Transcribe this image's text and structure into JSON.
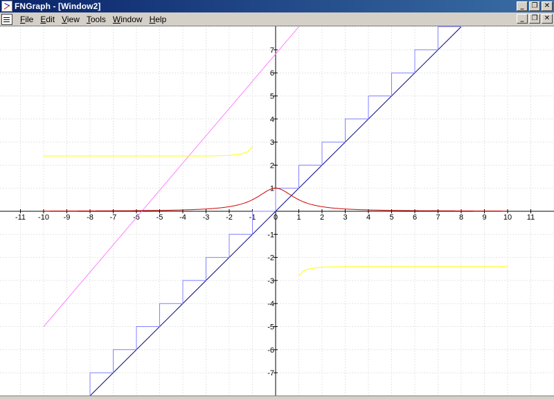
{
  "window": {
    "title": "FNGraph - [Window2]",
    "caption_buttons": [
      "_",
      "❐",
      "✕"
    ]
  },
  "menu": {
    "items": [
      "File",
      "Edit",
      "View",
      "Tools",
      "Window",
      "Help"
    ],
    "mnemonics": [
      "F",
      "E",
      "V",
      "T",
      "W",
      "H"
    ]
  },
  "chart_data": {
    "type": "line",
    "grid": true,
    "xlim": [
      -12,
      12
    ],
    "ylim": [
      -8,
      8
    ],
    "x_ticks": [
      -11,
      -10,
      -9,
      -8,
      -7,
      -6,
      -5,
      -4,
      -3,
      -2,
      -1,
      0,
      1,
      2,
      3,
      4,
      5,
      6,
      7,
      8,
      9,
      10,
      11
    ],
    "y_ticks": [
      -7,
      -6,
      -5,
      -4,
      -3,
      -2,
      -1,
      1,
      2,
      3,
      4,
      5,
      6,
      7
    ],
    "series": [
      {
        "color": "#ff80ff",
        "kind": "line",
        "x": [
          -10,
          1
        ],
        "y": [
          -5,
          8
        ]
      },
      {
        "color": "#000080",
        "kind": "line",
        "x": [
          -8,
          8
        ],
        "y": [
          -8,
          8
        ]
      },
      {
        "color": "#8080ff",
        "kind": "ceiling-step",
        "x_range": [
          -8,
          8
        ]
      },
      {
        "color": "#cc0000",
        "kind": "bell",
        "x_range": [
          -10,
          10
        ],
        "peak": 1
      },
      {
        "color": "#ffff00",
        "kind": "curve",
        "x": [
          -10,
          -3,
          -2,
          -1.5,
          -1.2,
          -1
        ],
        "y": [
          2.4,
          2.4,
          2.42,
          2.48,
          2.58,
          2.8
        ]
      },
      {
        "color": "#ffff00",
        "kind": "curve",
        "x": [
          1,
          1.2,
          1.5,
          2,
          3,
          10
        ],
        "y": [
          -2.8,
          -2.58,
          -2.48,
          -2.42,
          -2.4,
          -2.4
        ]
      }
    ]
  }
}
